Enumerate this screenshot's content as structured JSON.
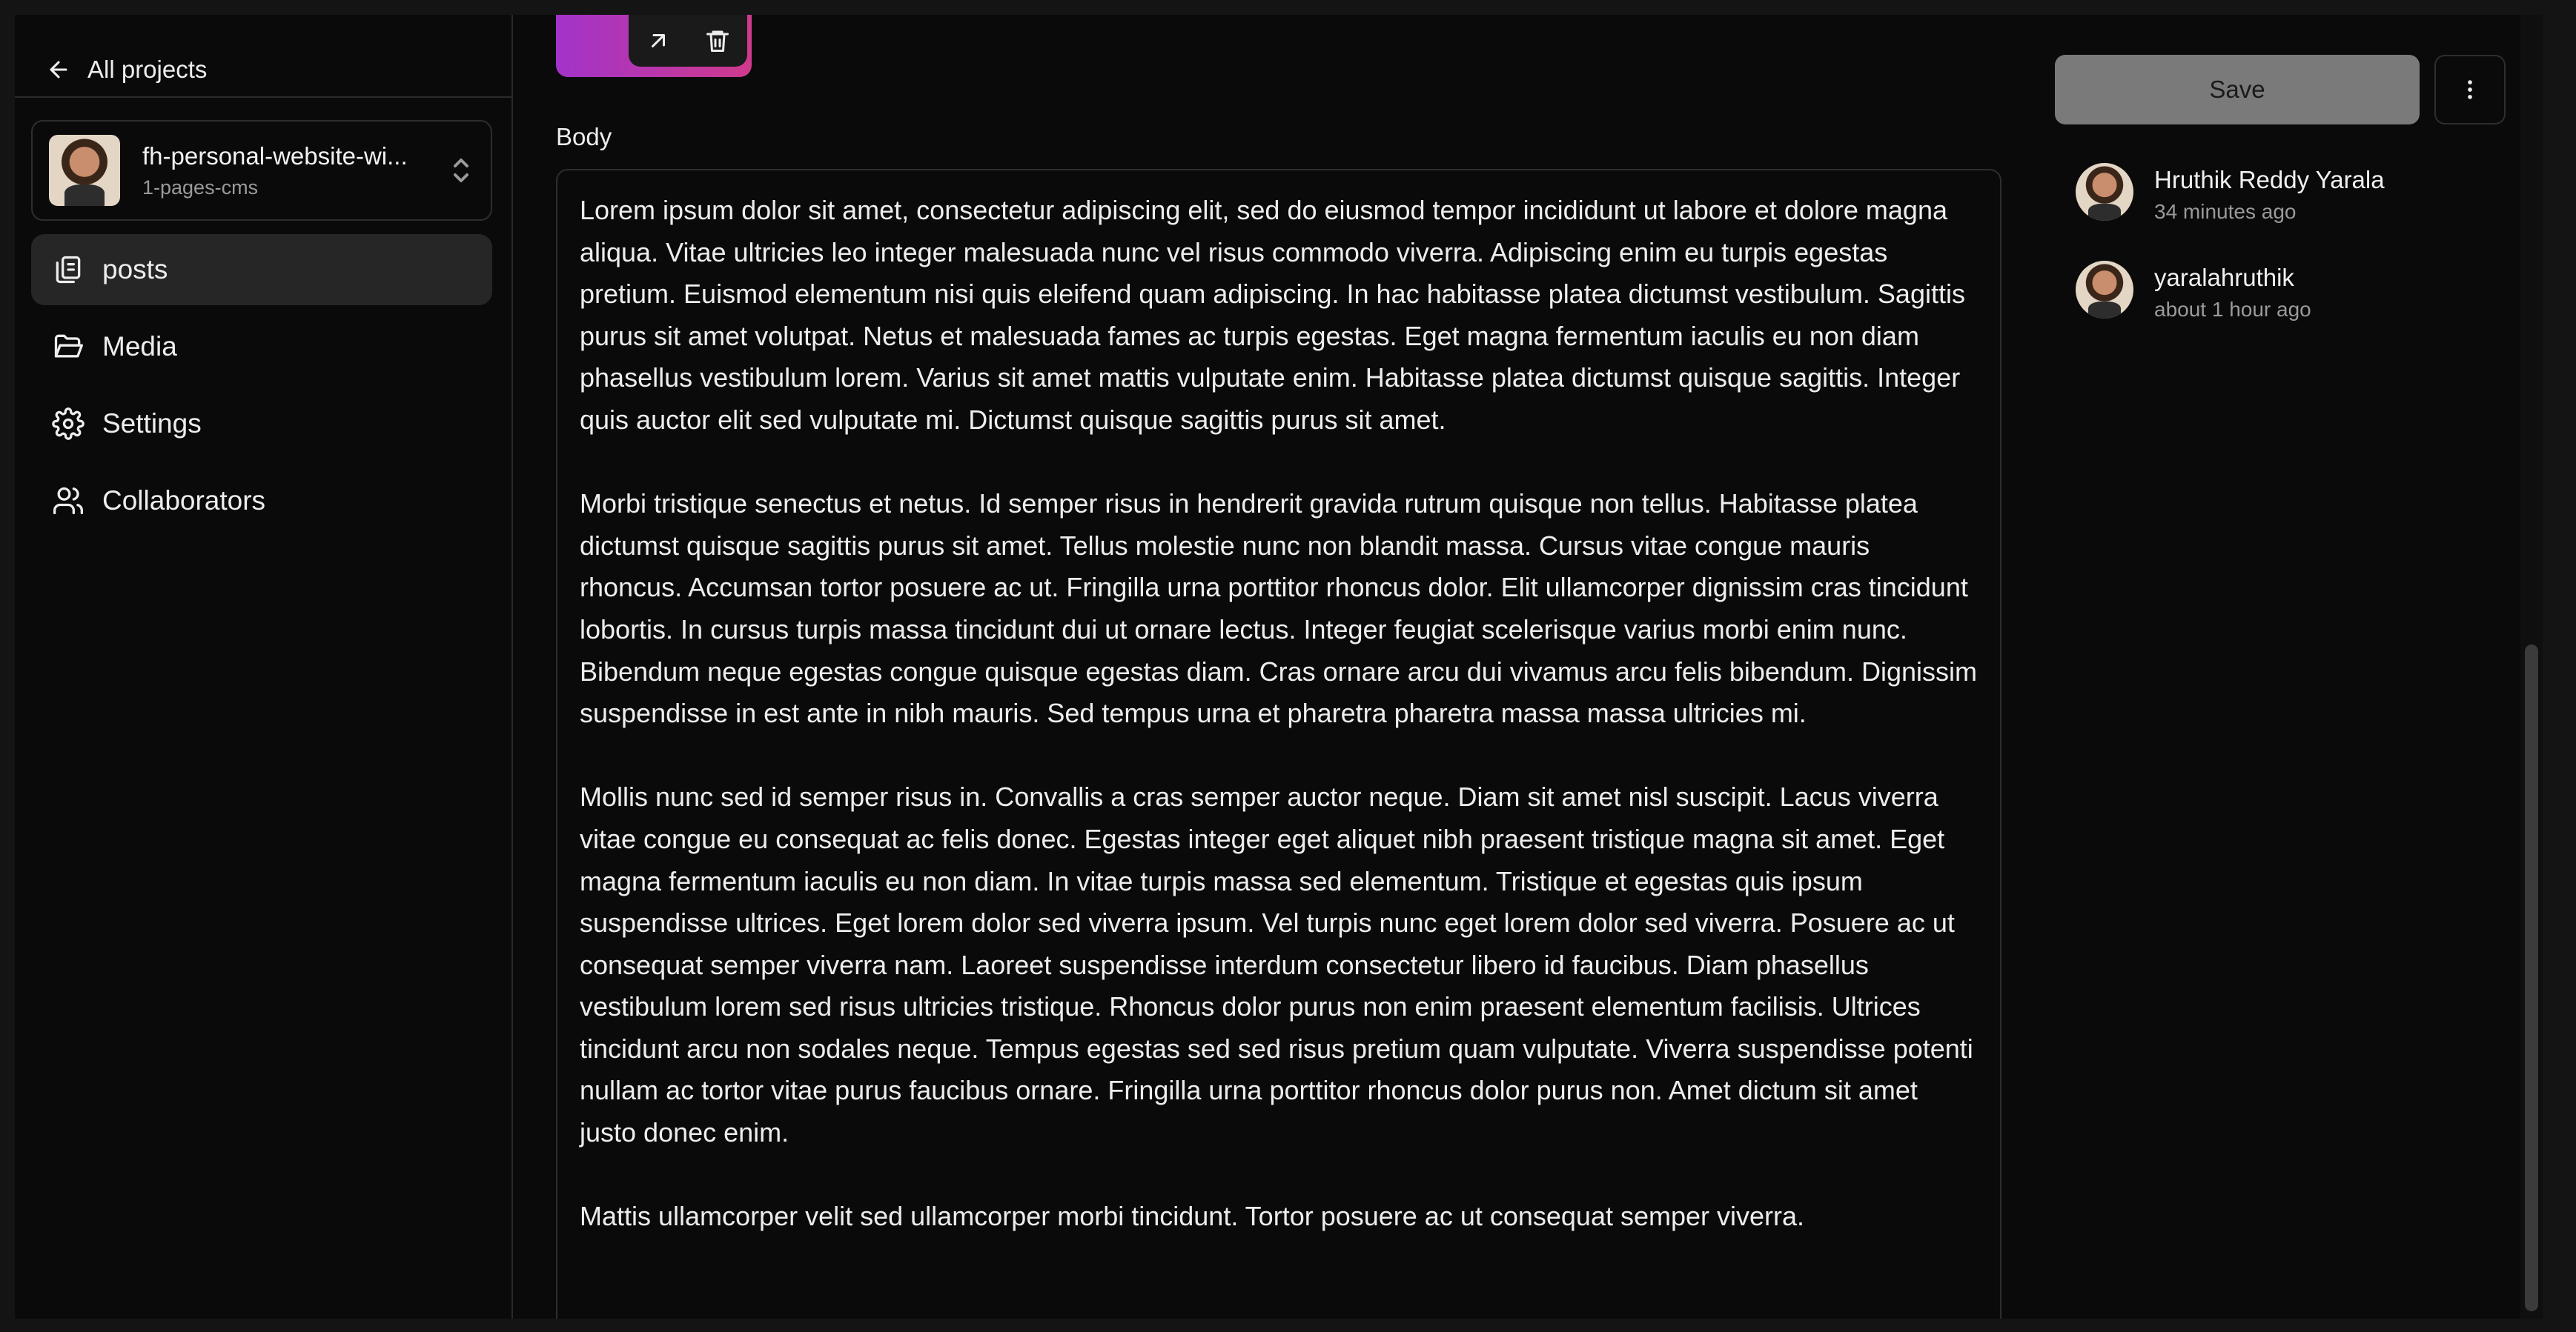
{
  "sidebar": {
    "back_label": "All projects",
    "project": {
      "name": "fh-personal-website-wi...",
      "branch": "1-pages-cms"
    },
    "nav": [
      {
        "label": "posts",
        "icon": "files-icon",
        "active": true
      },
      {
        "label": "Media",
        "icon": "folder-open-icon",
        "active": false
      },
      {
        "label": "Settings",
        "icon": "gear-icon",
        "active": false
      },
      {
        "label": "Collaborators",
        "icon": "users-icon",
        "active": false
      }
    ]
  },
  "editor": {
    "body_label": "Body",
    "paragraphs": [
      "Lorem ipsum dolor sit amet, consectetur adipiscing elit, sed do eiusmod tempor incididunt ut labore et dolore magna aliqua. Vitae ultricies leo integer malesuada nunc vel risus commodo viverra. Adipiscing enim eu turpis egestas pretium. Euismod elementum nisi quis eleifend quam adipiscing. In hac habitasse platea dictumst vestibulum. Sagittis purus sit amet volutpat. Netus et malesuada fames ac turpis egestas. Eget magna fermentum iaculis eu non diam phasellus vestibulum lorem. Varius sit amet mattis vulputate enim. Habitasse platea dictumst quisque sagittis. Integer quis auctor elit sed vulputate mi. Dictumst quisque sagittis purus sit amet.",
      "Morbi tristique senectus et netus. Id semper risus in hendrerit gravida rutrum quisque non tellus. Habitasse platea dictumst quisque sagittis purus sit amet. Tellus molestie nunc non blandit massa. Cursus vitae congue mauris rhoncus. Accumsan tortor posuere ac ut. Fringilla urna porttitor rhoncus dolor. Elit ullamcorper dignissim cras tincidunt lobortis. In cursus turpis massa tincidunt dui ut ornare lectus. Integer feugiat scelerisque varius morbi enim nunc. Bibendum neque egestas congue quisque egestas diam. Cras ornare arcu dui vivamus arcu felis bibendum. Dignissim suspendisse in est ante in nibh mauris. Sed tempus urna et pharetra pharetra massa massa ultricies mi.",
      "Mollis nunc sed id semper risus in. Convallis a cras semper auctor neque. Diam sit amet nisl suscipit. Lacus viverra vitae congue eu consequat ac felis donec. Egestas integer eget aliquet nibh praesent tristique magna sit amet. Eget magna fermentum iaculis eu non diam. In vitae turpis massa sed elementum. Tristique et egestas quis ipsum suspendisse ultrices. Eget lorem dolor sed viverra ipsum. Vel turpis nunc eget lorem dolor sed viverra. Posuere ac ut consequat semper viverra nam. Laoreet suspendisse interdum consectetur libero id faucibus. Diam phasellus vestibulum lorem sed risus ultricies tristique. Rhoncus dolor purus non enim praesent elementum facilisis. Ultrices tincidunt arcu non sodales neque. Tempus egestas sed sed risus pretium quam vulputate. Viverra suspendisse potenti nullam ac tortor vitae purus faucibus ornare. Fringilla urna porttitor rhoncus dolor purus non. Amet dictum sit amet justo donec enim.",
      "Mattis ullamcorper velit sed ullamcorper morbi tincidunt. Tortor posuere ac ut consequat semper viverra."
    ]
  },
  "actions": {
    "save_label": "Save"
  },
  "history": [
    {
      "name": "Hruthik Reddy Yarala",
      "time": "34 minutes ago"
    },
    {
      "name": "yaralahruthik",
      "time": "about 1 hour ago"
    }
  ],
  "colors": {
    "thumbnail_gradient_start": "#a233c9",
    "thumbnail_gradient_end": "#cf3a8c",
    "save_button_bg": "#7a7a7a",
    "active_nav_bg": "#262626"
  }
}
